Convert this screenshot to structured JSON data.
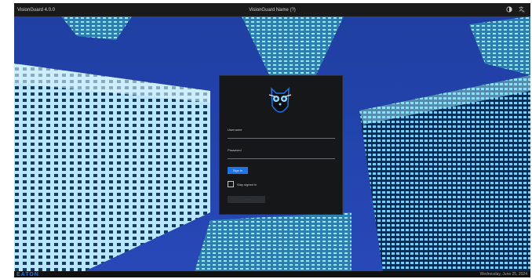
{
  "app": {
    "version": "VisionGuard 4.0.0",
    "title": "VisionGuard Name (?)"
  },
  "topbar_icons": [
    "contrast-icon",
    "language-icon"
  ],
  "login": {
    "username_label": "Username",
    "username_value": "",
    "password_label": "Password",
    "password_value": "",
    "sign_in_label": "Sign in",
    "stay_signed_in_label": "Stay signed in",
    "disabled_button_label": "· · · · · ·"
  },
  "footer": {
    "brand": "EATON",
    "date": "Wednesday, June 25, 2024"
  },
  "colors": {
    "accent": "#1d73e8",
    "panel": "#151718",
    "topbar": "#1a1a1a"
  }
}
